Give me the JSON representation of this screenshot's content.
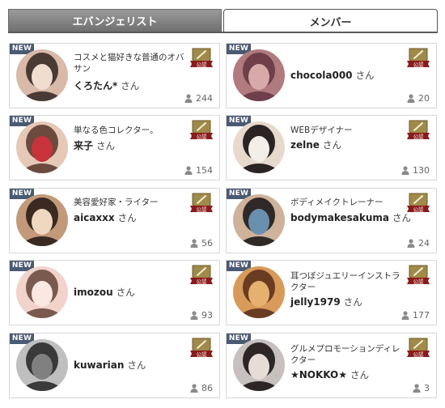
{
  "tabs": {
    "evangelist": "エバンジェリスト",
    "member": "メンバー"
  },
  "labels": {
    "new_badge": "NEW",
    "suffix": "さん",
    "official": "公認"
  },
  "members": [
    {
      "desc": "コスメと猫好きな普通のオバサン",
      "name": "くろたん*",
      "count": "244"
    },
    {
      "desc": "",
      "name": "chocola000",
      "count": "20"
    },
    {
      "desc": "単なる色コレクター。",
      "name": "来子",
      "count": "154"
    },
    {
      "desc": "WEBデザイナー",
      "name": "zelne",
      "count": "130"
    },
    {
      "desc": "美容愛好家・ライター",
      "name": "aicaxxx",
      "count": "56"
    },
    {
      "desc": "ボディメイクトレーナー",
      "name": "bodymakesakuma",
      "count": "24"
    },
    {
      "desc": "",
      "name": "imozou",
      "count": "93"
    },
    {
      "desc": "耳つぼジュエリーインストラクター",
      "name": "jelly1979",
      "count": "177"
    },
    {
      "desc": "",
      "name": "kuwarian",
      "count": "86"
    },
    {
      "desc": "グルメプロモーションディレクター",
      "name": "★NOKKO★",
      "count": "3"
    }
  ],
  "colors": {
    "badge": "#4a5a72",
    "seal_gold": "#a08a4a",
    "ribbon": "#8b1a1a"
  }
}
